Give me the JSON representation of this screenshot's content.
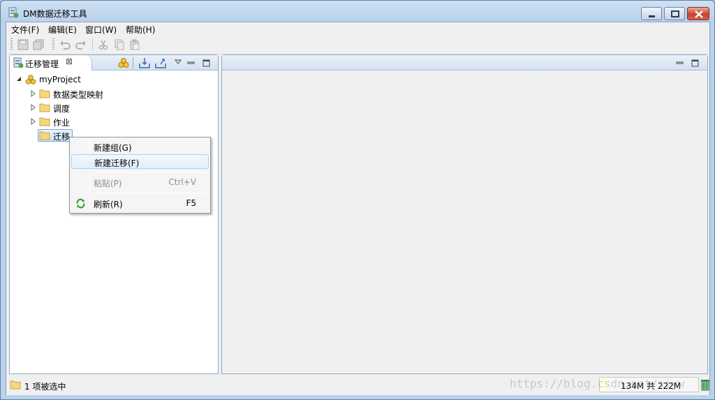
{
  "window": {
    "title": "DM数据迁移工具"
  },
  "menubar": {
    "items": [
      "文件(F)",
      "编辑(E)",
      "窗口(W)",
      "帮助(H)"
    ]
  },
  "toolbar": {
    "icons": [
      "save-icon",
      "save-all-icon",
      "undo-icon",
      "redo-icon",
      "cut-icon",
      "copy-icon",
      "paste-icon"
    ]
  },
  "left_panel": {
    "tab_label": "迁移管理",
    "tab_close": "⊠",
    "tree": {
      "root": "myProject",
      "children": [
        "数据类型映射",
        "调度",
        "作业",
        "迁移"
      ]
    }
  },
  "context_menu": {
    "items": [
      {
        "label": "新建组(G)",
        "shortcut": ""
      },
      {
        "label": "新建迁移(F)",
        "shortcut": ""
      },
      {
        "label": "粘贴(P)",
        "shortcut": "Ctrl+V"
      },
      {
        "label": "刷新(R)",
        "shortcut": "F5"
      }
    ]
  },
  "status": {
    "selection_text": "1 项被选中",
    "memory": "134M 共 222M"
  },
  "watermark": "https://blog.csdn.net/siyw"
}
